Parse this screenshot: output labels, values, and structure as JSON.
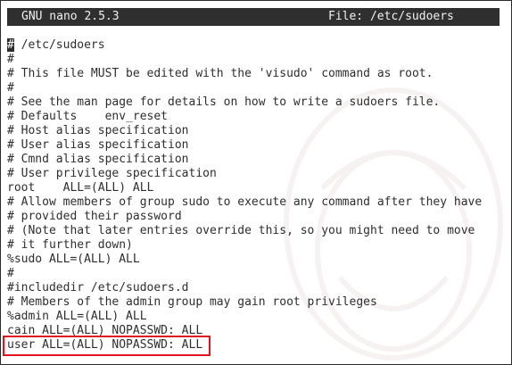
{
  "window": {
    "app_title": "GNU nano 2.5.3",
    "file_title": "File: /etc/sudoers"
  },
  "editor": {
    "cursor_char": "#",
    "first_line_rest": " /etc/sudoers",
    "lines": [
      "#",
      "# This file MUST be edited with the 'visudo' command as root.",
      "#",
      "# See the man page for details on how to write a sudoers file.",
      "# Defaults    env_reset",
      "# Host alias specification",
      "# User alias specification",
      "# Cmnd alias specification",
      "# User privilege specification",
      "root    ALL=(ALL) ALL",
      "# Allow members of group sudo to execute any command after they have",
      "# provided their password",
      "# (Note that later entries override this, so you might need to move",
      "# it further down)",
      "%sudo ALL=(ALL) ALL",
      "#",
      "#includedir /etc/sudoers.d",
      "# Members of the admin group may gain root privileges",
      "%admin ALL=(ALL) ALL",
      "cain ALL=(ALL) NOPASSWD: ALL",
      "user ALL=(ALL) NOPASSWD: ALL"
    ]
  },
  "colors": {
    "titlebar_bg": "#2f2f2f",
    "titlebar_text": "#f2f2f2",
    "text": "#2e2e2e",
    "highlight": "#e0141e"
  }
}
